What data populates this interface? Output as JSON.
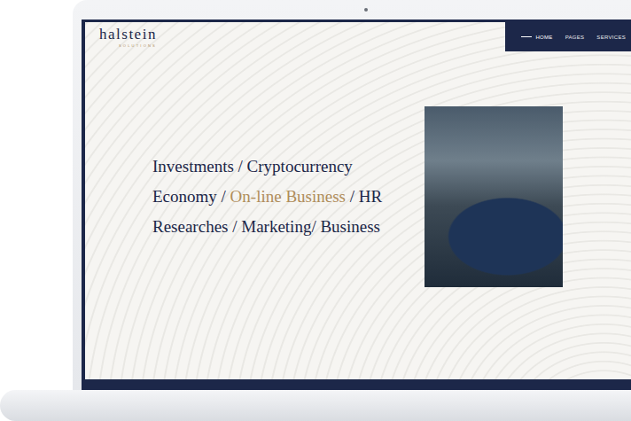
{
  "logo": {
    "name": "halstein",
    "tagline": "SOLUTIONS"
  },
  "nav": [
    {
      "label": "HOME",
      "selected": true
    },
    {
      "label": "PAGES",
      "selected": false
    },
    {
      "label": "SERVICES",
      "selected": false
    }
  ],
  "hero": {
    "lines": [
      [
        {
          "text": "Investments / Cryptocurrency",
          "highlight": false
        }
      ],
      [
        {
          "text": "Economy / ",
          "highlight": false
        },
        {
          "text": "On-line Business",
          "highlight": true
        },
        {
          "text": " / HR",
          "highlight": false
        }
      ],
      [
        {
          "text": "Researches / Marketing/ Business",
          "highlight": false
        }
      ]
    ]
  }
}
